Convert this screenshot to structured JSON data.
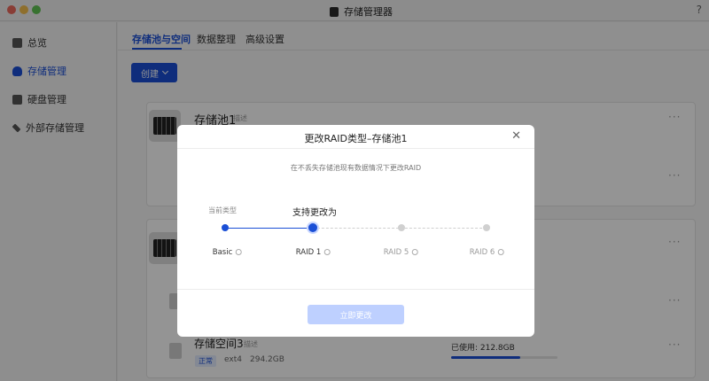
{
  "window": {
    "title": "存储管理器",
    "help_label": "?"
  },
  "sidebar": {
    "items": [
      {
        "label": "总览",
        "icon": "overview-icon"
      },
      {
        "label": "存储管理",
        "icon": "database-icon"
      },
      {
        "label": "硬盘管理",
        "icon": "disk-icon"
      },
      {
        "label": "外部存储管理",
        "icon": "external-storage-icon"
      }
    ],
    "active_index": 1
  },
  "tabs": [
    {
      "label": "存储池与空间"
    },
    {
      "label": "数据整理"
    },
    {
      "label": "高级设置"
    }
  ],
  "toolbar": {
    "create_label": "创建"
  },
  "pools": [
    {
      "title": "存储池1",
      "desc_label": "描述",
      "more_label": "···"
    },
    {
      "title": "",
      "more_label": "···"
    }
  ],
  "spaces": [
    {
      "title": "存储空间3",
      "desc_label": "描述",
      "status": "正常",
      "fs": "ext4",
      "size": "294.2GB",
      "used_label": "已使用: 212.8GB",
      "used_fraction": 0.65,
      "more_label": "···"
    }
  ],
  "modal": {
    "title": "更改RAID类型–存储池1",
    "subtitle": "在不丢失存储池现有数据情况下更改RAID",
    "current_type_label": "当前类型",
    "supported_label": "支持更改为",
    "steps": [
      {
        "label": "Basic",
        "state": "current"
      },
      {
        "label": "RAID 1",
        "state": "selected"
      },
      {
        "label": "RAID 5",
        "state": "unavailable"
      },
      {
        "label": "RAID 6",
        "state": "unavailable"
      }
    ],
    "apply_label": "立即更改",
    "close_label": "✕"
  },
  "colors": {
    "accent": "#1a4fd6",
    "overlay": "rgba(0,0,0,0.42)",
    "disabled_button": "#bed0ff"
  }
}
